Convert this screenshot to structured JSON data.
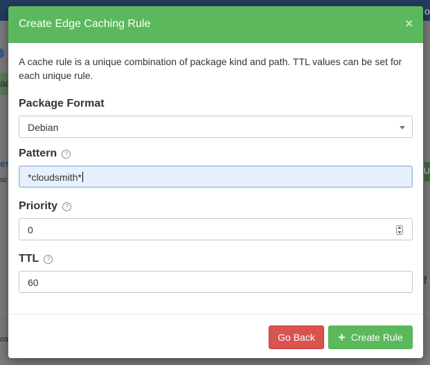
{
  "background": {
    "fragments": [
      "ad",
      "est",
      "sc",
      "U",
      "f",
      "oa",
      "o"
    ]
  },
  "modal": {
    "title": "Create Edge Caching Rule",
    "close_glyph": "×",
    "intro": "A cache rule is a unique combination of package kind and path. TTL values can be set for each unique rule.",
    "fields": {
      "package_format": {
        "label": "Package Format",
        "value": "Debian"
      },
      "pattern": {
        "label": "Pattern",
        "value": "*cloudsmith*"
      },
      "priority": {
        "label": "Priority",
        "value": "0"
      },
      "ttl": {
        "label": "TTL",
        "value": "60"
      }
    },
    "help_glyph": "?",
    "buttons": {
      "back": "Go Back",
      "create": "Create Rule",
      "create_icon": "+"
    }
  },
  "colors": {
    "header_green": "#5cb85c",
    "danger_red": "#d9534f",
    "focus_bg": "#e8f0fe"
  }
}
